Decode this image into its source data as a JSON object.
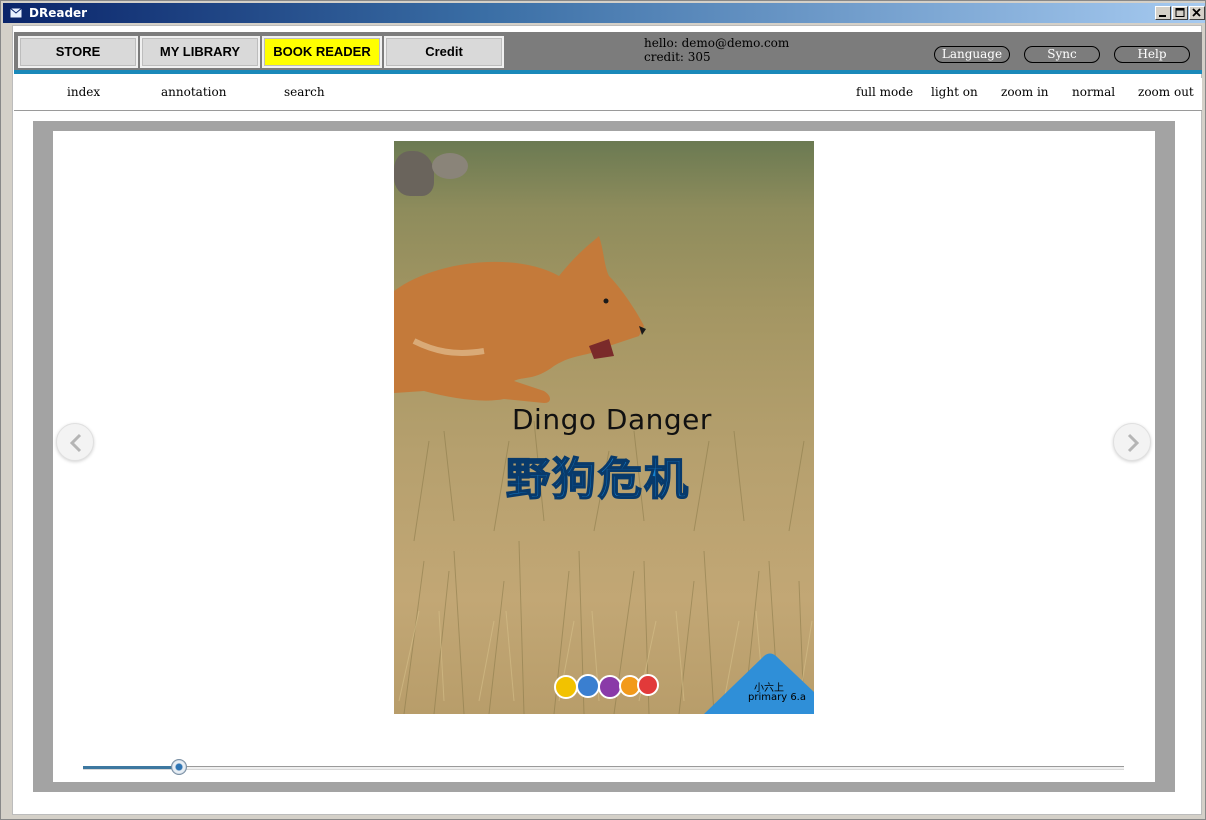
{
  "window": {
    "title": "DReader"
  },
  "nav": {
    "store": "STORE",
    "library": "MY LIBRARY",
    "reader": "BOOK READER",
    "credit": "Credit",
    "active_color": "#ffff00"
  },
  "user": {
    "hello": "hello: demo@demo.com",
    "credit": "credit: 305"
  },
  "pills": {
    "language": "Language",
    "sync": "Sync",
    "help": "Help"
  },
  "toolbar": {
    "index": "index",
    "annotation": "annotation",
    "search": "search",
    "full_mode": "full mode",
    "light_on": "light on",
    "zoom_in": "zoom in",
    "normal": "normal",
    "zoom_out": "zoom out"
  },
  "book": {
    "title_en": "Dingo Danger",
    "title_zh": "野狗危机",
    "grade_zh": "小六上",
    "grade_en": "primary 6.a"
  },
  "reader": {
    "progress": 0.092
  },
  "colors": {
    "accent_bar": "#1a89b9",
    "slider_fill": "#3d78a0",
    "title_zh": "#1784d2"
  }
}
